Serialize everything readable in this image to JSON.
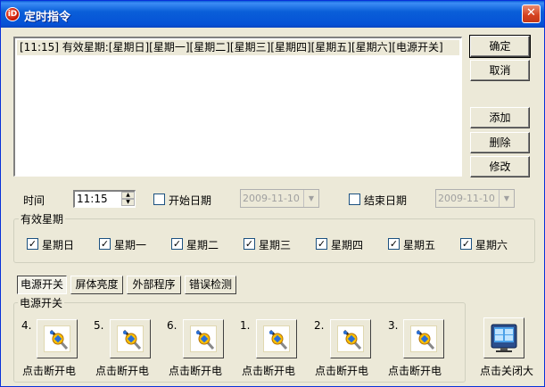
{
  "window": {
    "title": "定时指令",
    "close_glyph": "✕"
  },
  "command_list": {
    "items": [
      "[11:15] 有效星期:[星期日][星期一][星期二][星期三][星期四][星期五][星期六][电源开关]"
    ]
  },
  "buttons": {
    "ok": "确定",
    "cancel": "取消",
    "add": "添加",
    "delete": "删除",
    "modify": "修改"
  },
  "time": {
    "label": "时间",
    "value": "11:15"
  },
  "start_date": {
    "label": "开始日期",
    "checked": false,
    "value": "2009-11-10"
  },
  "end_date": {
    "label": "结束日期",
    "checked": false,
    "value": "2009-11-10"
  },
  "weekdays": {
    "legend": "有效星期",
    "days": [
      {
        "label": "星期日",
        "checked": true
      },
      {
        "label": "星期一",
        "checked": true
      },
      {
        "label": "星期二",
        "checked": true
      },
      {
        "label": "星期三",
        "checked": true
      },
      {
        "label": "星期四",
        "checked": true
      },
      {
        "label": "星期五",
        "checked": true
      },
      {
        "label": "星期六",
        "checked": true
      }
    ]
  },
  "tabs": [
    "电源开关",
    "屏体亮度",
    "外部程序",
    "错误检测"
  ],
  "power_group": {
    "legend": "电源开关",
    "switches": [
      {
        "number": "4.",
        "caption": "点击断开电"
      },
      {
        "number": "5.",
        "caption": "点击断开电"
      },
      {
        "number": "6.",
        "caption": "点击断开电"
      },
      {
        "number": "1.",
        "caption": "点击断开电"
      },
      {
        "number": "2.",
        "caption": "点击断开电"
      },
      {
        "number": "3.",
        "caption": "点击断开电"
      }
    ]
  },
  "close_screen": {
    "caption": "点击关闭大"
  },
  "icons": {
    "app": "app-logo-icon",
    "switch": "power-plug-icon",
    "screen": "monitor-icon"
  }
}
